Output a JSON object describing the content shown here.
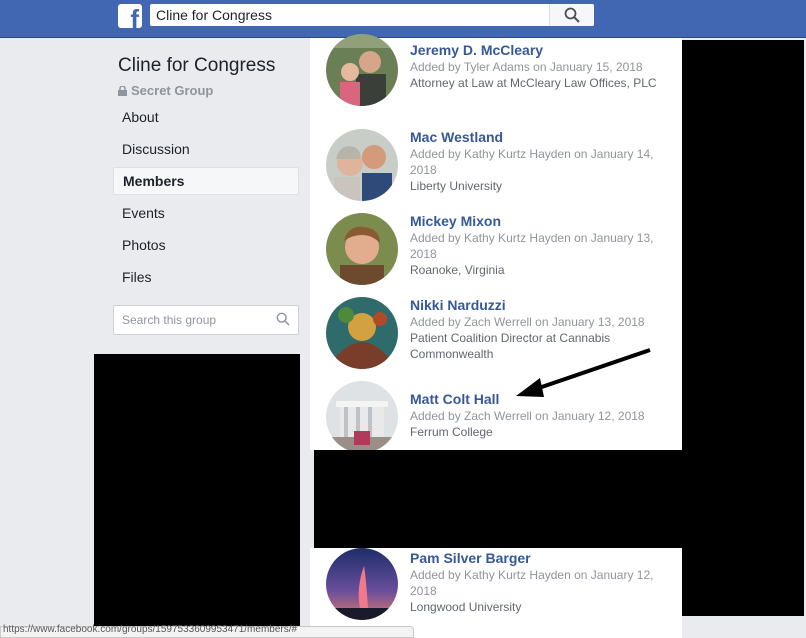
{
  "topbar": {
    "logo_glyph": "f",
    "search_value": "Cline for Congress",
    "search_icon": "search-icon"
  },
  "group": {
    "title": "Cline for Congress",
    "privacy": "Secret Group"
  },
  "nav": [
    {
      "label": "About",
      "active": false
    },
    {
      "label": "Discussion",
      "active": false
    },
    {
      "label": "Members",
      "active": true
    },
    {
      "label": "Events",
      "active": false
    },
    {
      "label": "Photos",
      "active": false
    },
    {
      "label": "Files",
      "active": false
    }
  ],
  "side_search": {
    "placeholder": "Search this group"
  },
  "members": [
    {
      "name": "Jeremy D. McCleary",
      "added": "Added by Tyler Adams on January 15, 2018",
      "info": "Attorney at Law at McCleary Law Offices, PLC"
    },
    {
      "name": "Mac Westland",
      "added": "Added by Kathy Kurtz Hayden on January 14, 2018",
      "info": "Liberty University"
    },
    {
      "name": "Mickey Mixon",
      "added": "Added by Kathy Kurtz Hayden on January 13, 2018",
      "info": "Roanoke, Virginia"
    },
    {
      "name": "Nikki Narduzzi",
      "added": "Added by Zach Werrell on January 13, 2018",
      "info": "Patient Coalition Director at Cannabis Commonwealth"
    },
    {
      "name": "Matt Colt Hall",
      "added": "Added by Zach Werrell on January 12, 2018",
      "info": "Ferrum College"
    },
    {
      "name": "Pam Silver Barger",
      "added": "Added by Kathy Kurtz Hayden on January 12, 2018",
      "info": "Longwood University"
    }
  ],
  "colors": {
    "brand": "#4267b2",
    "link": "#365899",
    "annotation": "#000000"
  },
  "status_bar": {
    "text": "https://www.facebook.com/groups/1597533609953471/members/#"
  }
}
